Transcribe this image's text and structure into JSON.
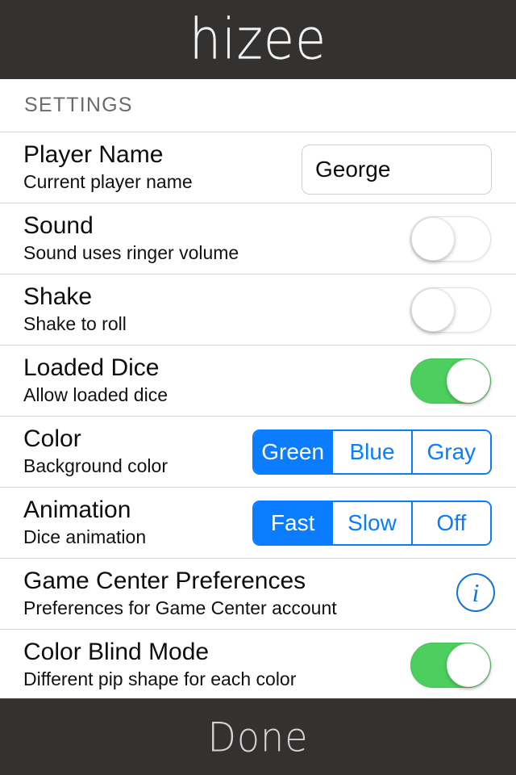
{
  "header": {
    "title": "hizee",
    "background_color": "#343231"
  },
  "section": {
    "label": "SETTINGS"
  },
  "rows": [
    {
      "title": "Player Name",
      "subtitle": "Current player name",
      "control": "text-input",
      "value": "George"
    },
    {
      "title": "Sound",
      "subtitle": "Sound uses ringer volume",
      "control": "toggle",
      "state": "off"
    },
    {
      "title": "Shake",
      "subtitle": "Shake to roll",
      "control": "toggle",
      "state": "off"
    },
    {
      "title": "Loaded Dice",
      "subtitle": "Allow loaded dice",
      "control": "toggle",
      "state": "on"
    },
    {
      "title": "Color",
      "subtitle": "Background color",
      "control": "segmented",
      "options": [
        "Green",
        "Blue",
        "Gray"
      ],
      "selected": "Green"
    },
    {
      "title": "Animation",
      "subtitle": "Dice animation",
      "control": "segmented",
      "options": [
        "Fast",
        "Slow",
        "Off"
      ],
      "selected": "Fast"
    },
    {
      "title": "Game Center Preferences",
      "subtitle": "Preferences for Game Center account",
      "control": "info-button",
      "icon": "info-icon",
      "icon_glyph": "i"
    },
    {
      "title": "Color Blind Mode",
      "subtitle": "Different pip shape for each color",
      "control": "toggle",
      "state": "on"
    }
  ],
  "footer": {
    "done_label": "Done",
    "background_color": "#343231"
  },
  "colors": {
    "accent_blue": "#0a7cff",
    "toggle_on_green": "#4ccf5e",
    "info_blue": "#1b75d0",
    "bar_dark": "#343231",
    "divider": "#d6d6d6"
  }
}
